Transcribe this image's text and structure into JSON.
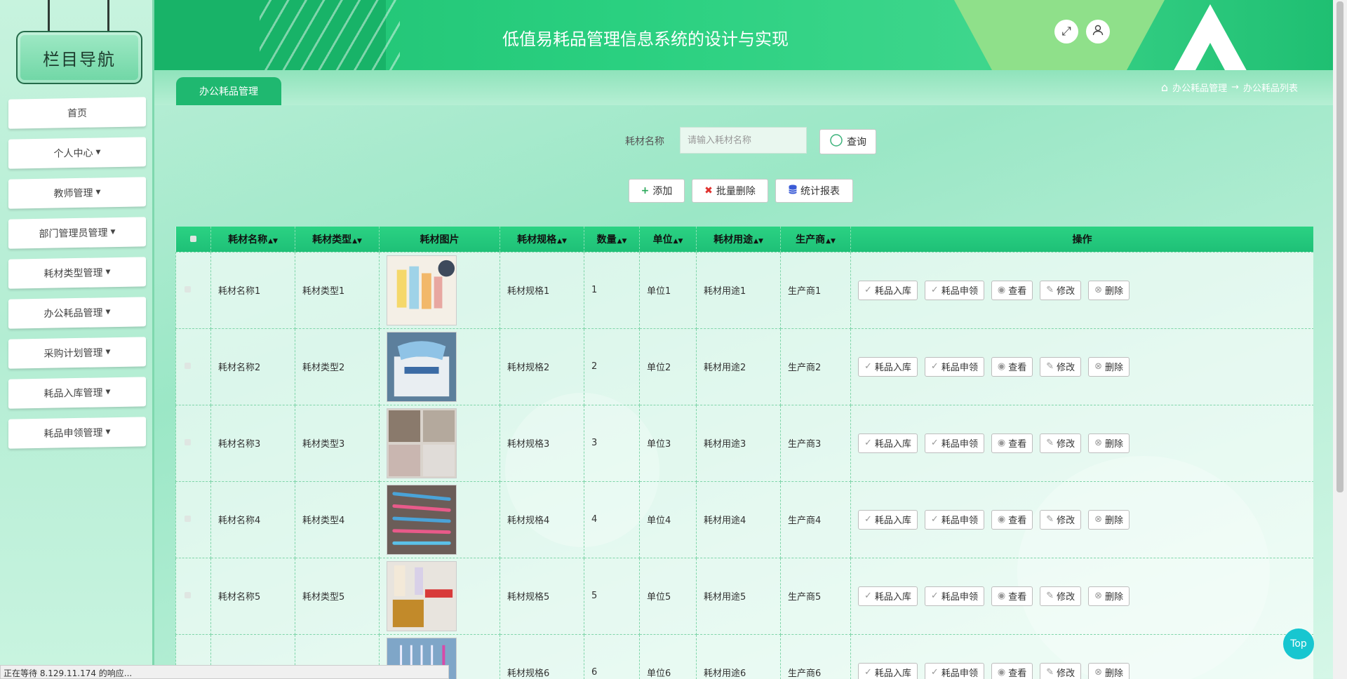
{
  "header": {
    "title": "低值易耗品管理信息系统的设计与实现"
  },
  "sidebar": {
    "title": "栏目导航",
    "items": [
      {
        "label": "首页",
        "dropdown": false
      },
      {
        "label": "个人中心",
        "dropdown": true
      },
      {
        "label": "教师管理",
        "dropdown": true
      },
      {
        "label": "部门管理员管理",
        "dropdown": true
      },
      {
        "label": "耗材类型管理",
        "dropdown": true
      },
      {
        "label": "办公耗品管理",
        "dropdown": true
      },
      {
        "label": "采购计划管理",
        "dropdown": true
      },
      {
        "label": "耗品入库管理",
        "dropdown": true
      },
      {
        "label": "耗品申领管理",
        "dropdown": true
      }
    ]
  },
  "tab": {
    "label": "办公耗品管理"
  },
  "breadcrumb": {
    "parent": "办公耗品管理",
    "arrow": "→",
    "current": "办公耗品列表"
  },
  "search": {
    "label": "耗材名称",
    "placeholder": "请输入耗材名称",
    "button": "查询"
  },
  "actions": {
    "add": "添加",
    "batch_delete": "批量删除",
    "report": "统计报表"
  },
  "table": {
    "columns": [
      "耗材名称",
      "耗材类型",
      "耗材图片",
      "耗材规格",
      "数量",
      "单位",
      "耗材用途",
      "生产商",
      "操作"
    ],
    "row_buttons": [
      "耗品入库",
      "耗品申领",
      "查看",
      "修改",
      "删除"
    ],
    "rows": [
      {
        "name": "耗材名称1",
        "type": "耗材类型1",
        "spec": "耗材规格1",
        "qty": "1",
        "unit": "单位1",
        "use": "耗材用途1",
        "maker": "生产商1"
      },
      {
        "name": "耗材名称2",
        "type": "耗材类型2",
        "spec": "耗材规格2",
        "qty": "2",
        "unit": "单位2",
        "use": "耗材用途2",
        "maker": "生产商2"
      },
      {
        "name": "耗材名称3",
        "type": "耗材类型3",
        "spec": "耗材规格3",
        "qty": "3",
        "unit": "单位3",
        "use": "耗材用途3",
        "maker": "生产商3"
      },
      {
        "name": "耗材名称4",
        "type": "耗材类型4",
        "spec": "耗材规格4",
        "qty": "4",
        "unit": "单位4",
        "use": "耗材用途4",
        "maker": "生产商4"
      },
      {
        "name": "耗材名称5",
        "type": "耗材类型5",
        "spec": "耗材规格5",
        "qty": "5",
        "unit": "单位5",
        "use": "耗材用途5",
        "maker": "生产商5"
      },
      {
        "name": "",
        "type": "",
        "spec": "耗材规格6",
        "qty": "6",
        "unit": "单位6",
        "use": "耗材用途6",
        "maker": "生产商6"
      }
    ]
  },
  "status_bar": "正在等待 8.129.11.174 的响应...",
  "top_button": "Top",
  "colors": {
    "primary": "#1fbf72",
    "accent": "#17c6d0",
    "header_trapezoid": "#8fe08a"
  }
}
